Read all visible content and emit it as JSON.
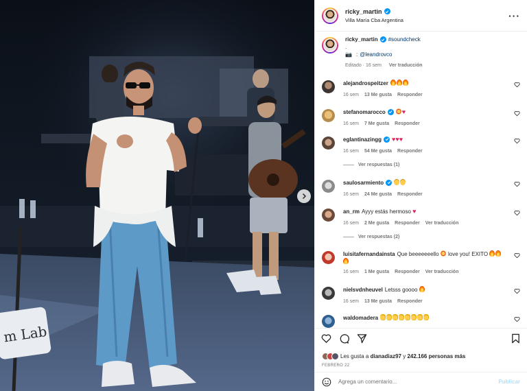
{
  "post": {
    "author": "ricky_martin",
    "location": "Villa María Cba Argentina",
    "caption": {
      "hashtag": "#soundcheck",
      "dot": ".",
      "mention": "@leandrovco",
      "edited": "Editado · 16 sem",
      "translate": "Ver traducción"
    }
  },
  "comments": [
    {
      "user": "alejandrospeitzer",
      "text": "",
      "emojis": [
        "fire",
        "fire",
        "fire"
      ],
      "time": "16 sem",
      "likes": "13 Me gusta",
      "reply": "Responder",
      "translate": ""
    },
    {
      "user": "stefanomarocco",
      "verified": true,
      "text": "",
      "emojis": [
        "star",
        "heart"
      ],
      "time": "16 sem",
      "likes": "7 Me gusta",
      "reply": "Responder",
      "translate": ""
    },
    {
      "user": "eglantinazingg",
      "verified": true,
      "text": "",
      "emojis": [
        "heart",
        "heart",
        "heart"
      ],
      "time": "16 sem",
      "likes": "54 Me gusta",
      "reply": "Responder",
      "translate": "",
      "replies": "Ver respuestas (1)"
    },
    {
      "user": "saulosarmiento",
      "verified": true,
      "text": "",
      "emojis": [
        "scream",
        "scream"
      ],
      "time": "16 sem",
      "likes": "24 Me gusta",
      "reply": "Responder",
      "translate": ""
    },
    {
      "user": "an_rm",
      "text": "Ayyy estás hermoso",
      "emojis": [
        "heart"
      ],
      "time": "16 sem",
      "likes": "2 Me gusta",
      "reply": "Responder",
      "translate": "Ver traducción",
      "replies": "Ver respuestas (2)"
    },
    {
      "user": "luisitafernandainsta",
      "text": "Que beeeeeeello",
      "text2": "love you! EXITO",
      "emojis": [
        "fire"
      ],
      "time": "16 sem",
      "likes": "1 Me gusta",
      "reply": "Responder",
      "translate": "Ver traducción"
    },
    {
      "user": "nielsvdnheuvel",
      "text": "Letsss goooo",
      "emojis": [
        "fire"
      ],
      "time": "16 sem",
      "likes": "13 Me gusta",
      "reply": "Responder",
      "translate": ""
    },
    {
      "user": "waldomadera",
      "text": "",
      "emojis": [
        "clap",
        "clap",
        "clap",
        "clap",
        "clap",
        "clap",
        "clap",
        "clap"
      ],
      "time": "",
      "likes": "",
      "reply": "",
      "translate": ""
    }
  ],
  "likes": {
    "prefix": "Les gusta a",
    "user": "dianadiaz97",
    "joiner": "y",
    "count": "242.166 personas más"
  },
  "date": "FEBRERO 22",
  "add_comment": {
    "placeholder": "Agrega un comentario...",
    "post_label": "Publicar"
  },
  "colors": {
    "link": "#00376b",
    "verified": "#0095f6",
    "muted": "#737373",
    "post_disabled": "#b2dffc"
  }
}
